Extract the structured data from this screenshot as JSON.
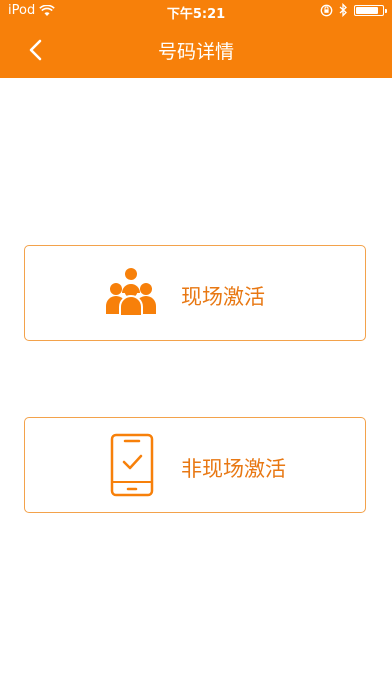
{
  "status_bar": {
    "carrier": "iPod",
    "time": "下午5:21",
    "battery_level": 0.9,
    "icons": [
      "wifi-icon",
      "rotation-lock-icon",
      "bluetooth-icon",
      "battery-icon"
    ]
  },
  "navbar": {
    "title": "号码详情",
    "back_icon": "chevron-left-icon"
  },
  "options": [
    {
      "label": "现场激活",
      "icon": "group-people-icon"
    },
    {
      "label": "非现场激活",
      "icon": "phone-check-icon"
    }
  ],
  "colors": {
    "accent": "#f7800a",
    "card_border": "#f3a24b",
    "label": "#e87813"
  }
}
